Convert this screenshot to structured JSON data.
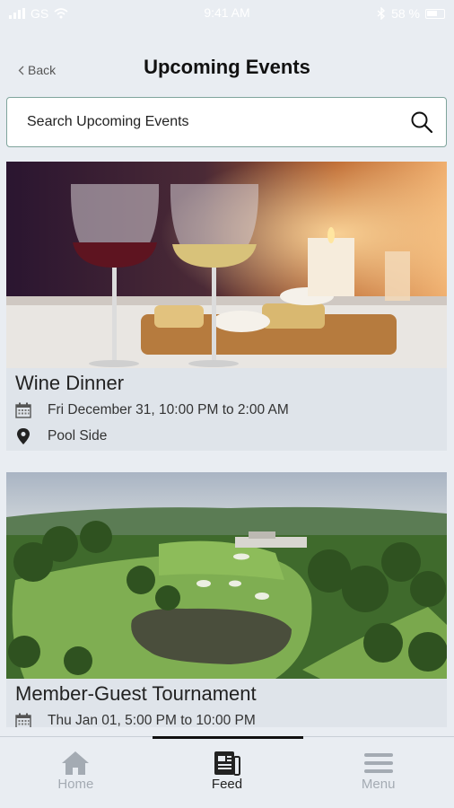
{
  "status": {
    "carrier": "GS",
    "time": "9:41 AM",
    "battery": "58 %"
  },
  "header": {
    "back_label": "Back",
    "title": "Upcoming Events"
  },
  "search": {
    "placeholder": "Search Upcoming Events"
  },
  "events": [
    {
      "title": "Wine Dinner",
      "datetime": "Fri December 31, 10:00 PM to 2:00 AM",
      "location": "Pool Side"
    },
    {
      "title": "Member-Guest Tournament",
      "datetime": "Thu Jan 01, 5:00 PM to 10:00 PM"
    }
  ],
  "tabbar": {
    "items": [
      {
        "label": "Home",
        "icon": "home-icon"
      },
      {
        "label": "Feed",
        "icon": "feed-icon"
      },
      {
        "label": "Menu",
        "icon": "menu-icon"
      }
    ],
    "active": "Feed"
  },
  "colors": {
    "background": "#e9edf2",
    "card": "#dfe4ea",
    "search_border": "#7fa49c",
    "tab_active": "#222222",
    "tab_inactive": "#a4abb3"
  }
}
